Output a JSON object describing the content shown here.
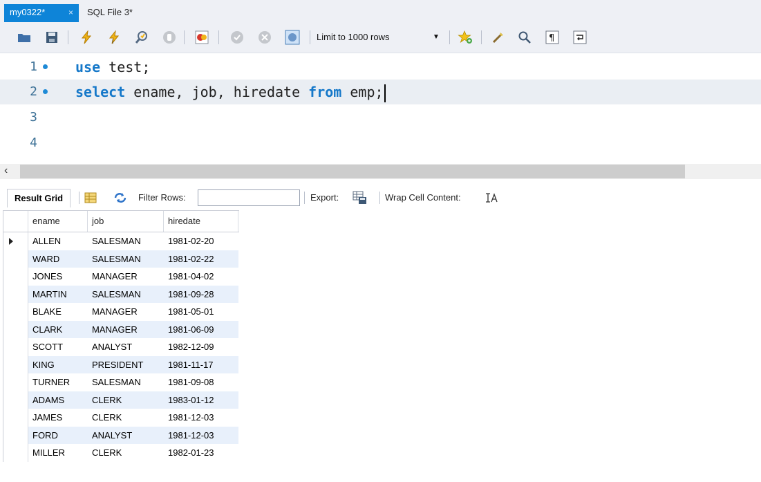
{
  "tabs": [
    {
      "label": "my0322*",
      "active": true,
      "close": "×"
    },
    {
      "label": "SQL File 3*",
      "active": false
    }
  ],
  "toolbar": {
    "limit_label": "Limit to 1000 rows",
    "icons": [
      "folder-open-icon",
      "save-icon",
      "execute-icon",
      "execute-current-icon",
      "explain-icon",
      "stop-icon",
      "toggle-error-icon",
      "commit-icon",
      "rollback-icon",
      "autocommit-icon",
      "bookmark-icon",
      "beautify-icon",
      "find-icon",
      "invisible-chars-icon",
      "wrap-icon"
    ]
  },
  "editor": {
    "lines": [
      {
        "num": "1",
        "dot": true
      },
      {
        "num": "2",
        "dot": true
      },
      {
        "num": "3",
        "dot": false
      },
      {
        "num": "4",
        "dot": false
      }
    ],
    "line1": {
      "kw": "use",
      "rest": " test;"
    },
    "line2": {
      "kw1": "select",
      "mid": " ename, job, hiredate ",
      "kw2": "from",
      "rest": " emp;"
    }
  },
  "result_toolbar": {
    "tab_label": "Result Grid",
    "filter_label": "Filter Rows:",
    "filter_value": "",
    "export_label": "Export:",
    "wrap_label": "Wrap Cell Content:"
  },
  "grid": {
    "columns": [
      "ename",
      "job",
      "hiredate"
    ],
    "rows": [
      [
        "ALLEN",
        "SALESMAN",
        "1981-02-20"
      ],
      [
        "WARD",
        "SALESMAN",
        "1981-02-22"
      ],
      [
        "JONES",
        "MANAGER",
        "1981-04-02"
      ],
      [
        "MARTIN",
        "SALESMAN",
        "1981-09-28"
      ],
      [
        "BLAKE",
        "MANAGER",
        "1981-05-01"
      ],
      [
        "CLARK",
        "MANAGER",
        "1981-06-09"
      ],
      [
        "SCOTT",
        "ANALYST",
        "1982-12-09"
      ],
      [
        "KING",
        "PRESIDENT",
        "1981-11-17"
      ],
      [
        "TURNER",
        "SALESMAN",
        "1981-09-08"
      ],
      [
        "ADAMS",
        "CLERK",
        "1983-01-12"
      ],
      [
        "JAMES",
        "CLERK",
        "1981-12-03"
      ],
      [
        "FORD",
        "ANALYST",
        "1981-12-03"
      ],
      [
        "MILLER",
        "CLERK",
        "1982-01-23"
      ]
    ],
    "current_row": 0
  },
  "colors": {
    "active_tab": "#0e84d8",
    "keyword": "#1578c9",
    "line_number": "#3a6f95",
    "alt_row": "#e8f0fb"
  }
}
